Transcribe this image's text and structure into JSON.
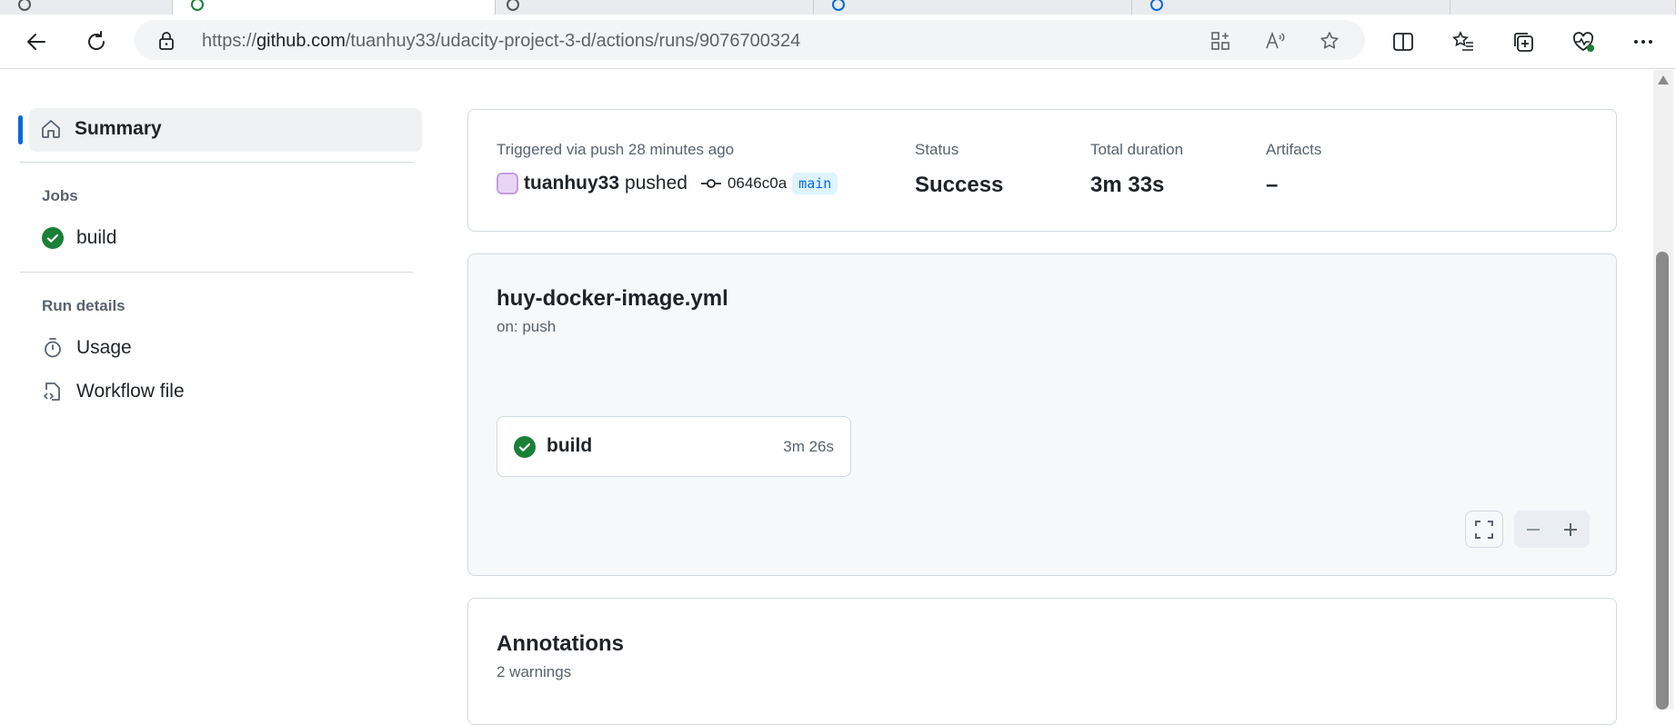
{
  "browser": {
    "url_prefix": "https://",
    "url_host": "github.com",
    "url_path": "/tuanhuy33/udacity-project-3-d/actions/runs/9076700324"
  },
  "sidebar": {
    "summary_label": "Summary",
    "jobs_heading": "Jobs",
    "jobs": [
      {
        "label": "build"
      }
    ],
    "run_details_heading": "Run details",
    "run_details": [
      {
        "label": "Usage"
      },
      {
        "label": "Workflow file"
      }
    ]
  },
  "run_summary": {
    "triggered_text": "Triggered via push 28 minutes ago",
    "actor": "tuanhuy33",
    "action": "pushed",
    "commit_sha": "0646c0a",
    "branch": "main",
    "status_label": "Status",
    "status_value": "Success",
    "duration_label": "Total duration",
    "duration_value": "3m 33s",
    "artifacts_label": "Artifacts",
    "artifacts_value": "–"
  },
  "workflow": {
    "file_name": "huy-docker-image.yml",
    "trigger": "on: push",
    "job_name": "build",
    "job_duration": "3m 26s"
  },
  "annotations": {
    "title": "Annotations",
    "subtitle": "2 warnings"
  },
  "colors": {
    "accent": "#0969da",
    "success": "#1a7f37"
  }
}
